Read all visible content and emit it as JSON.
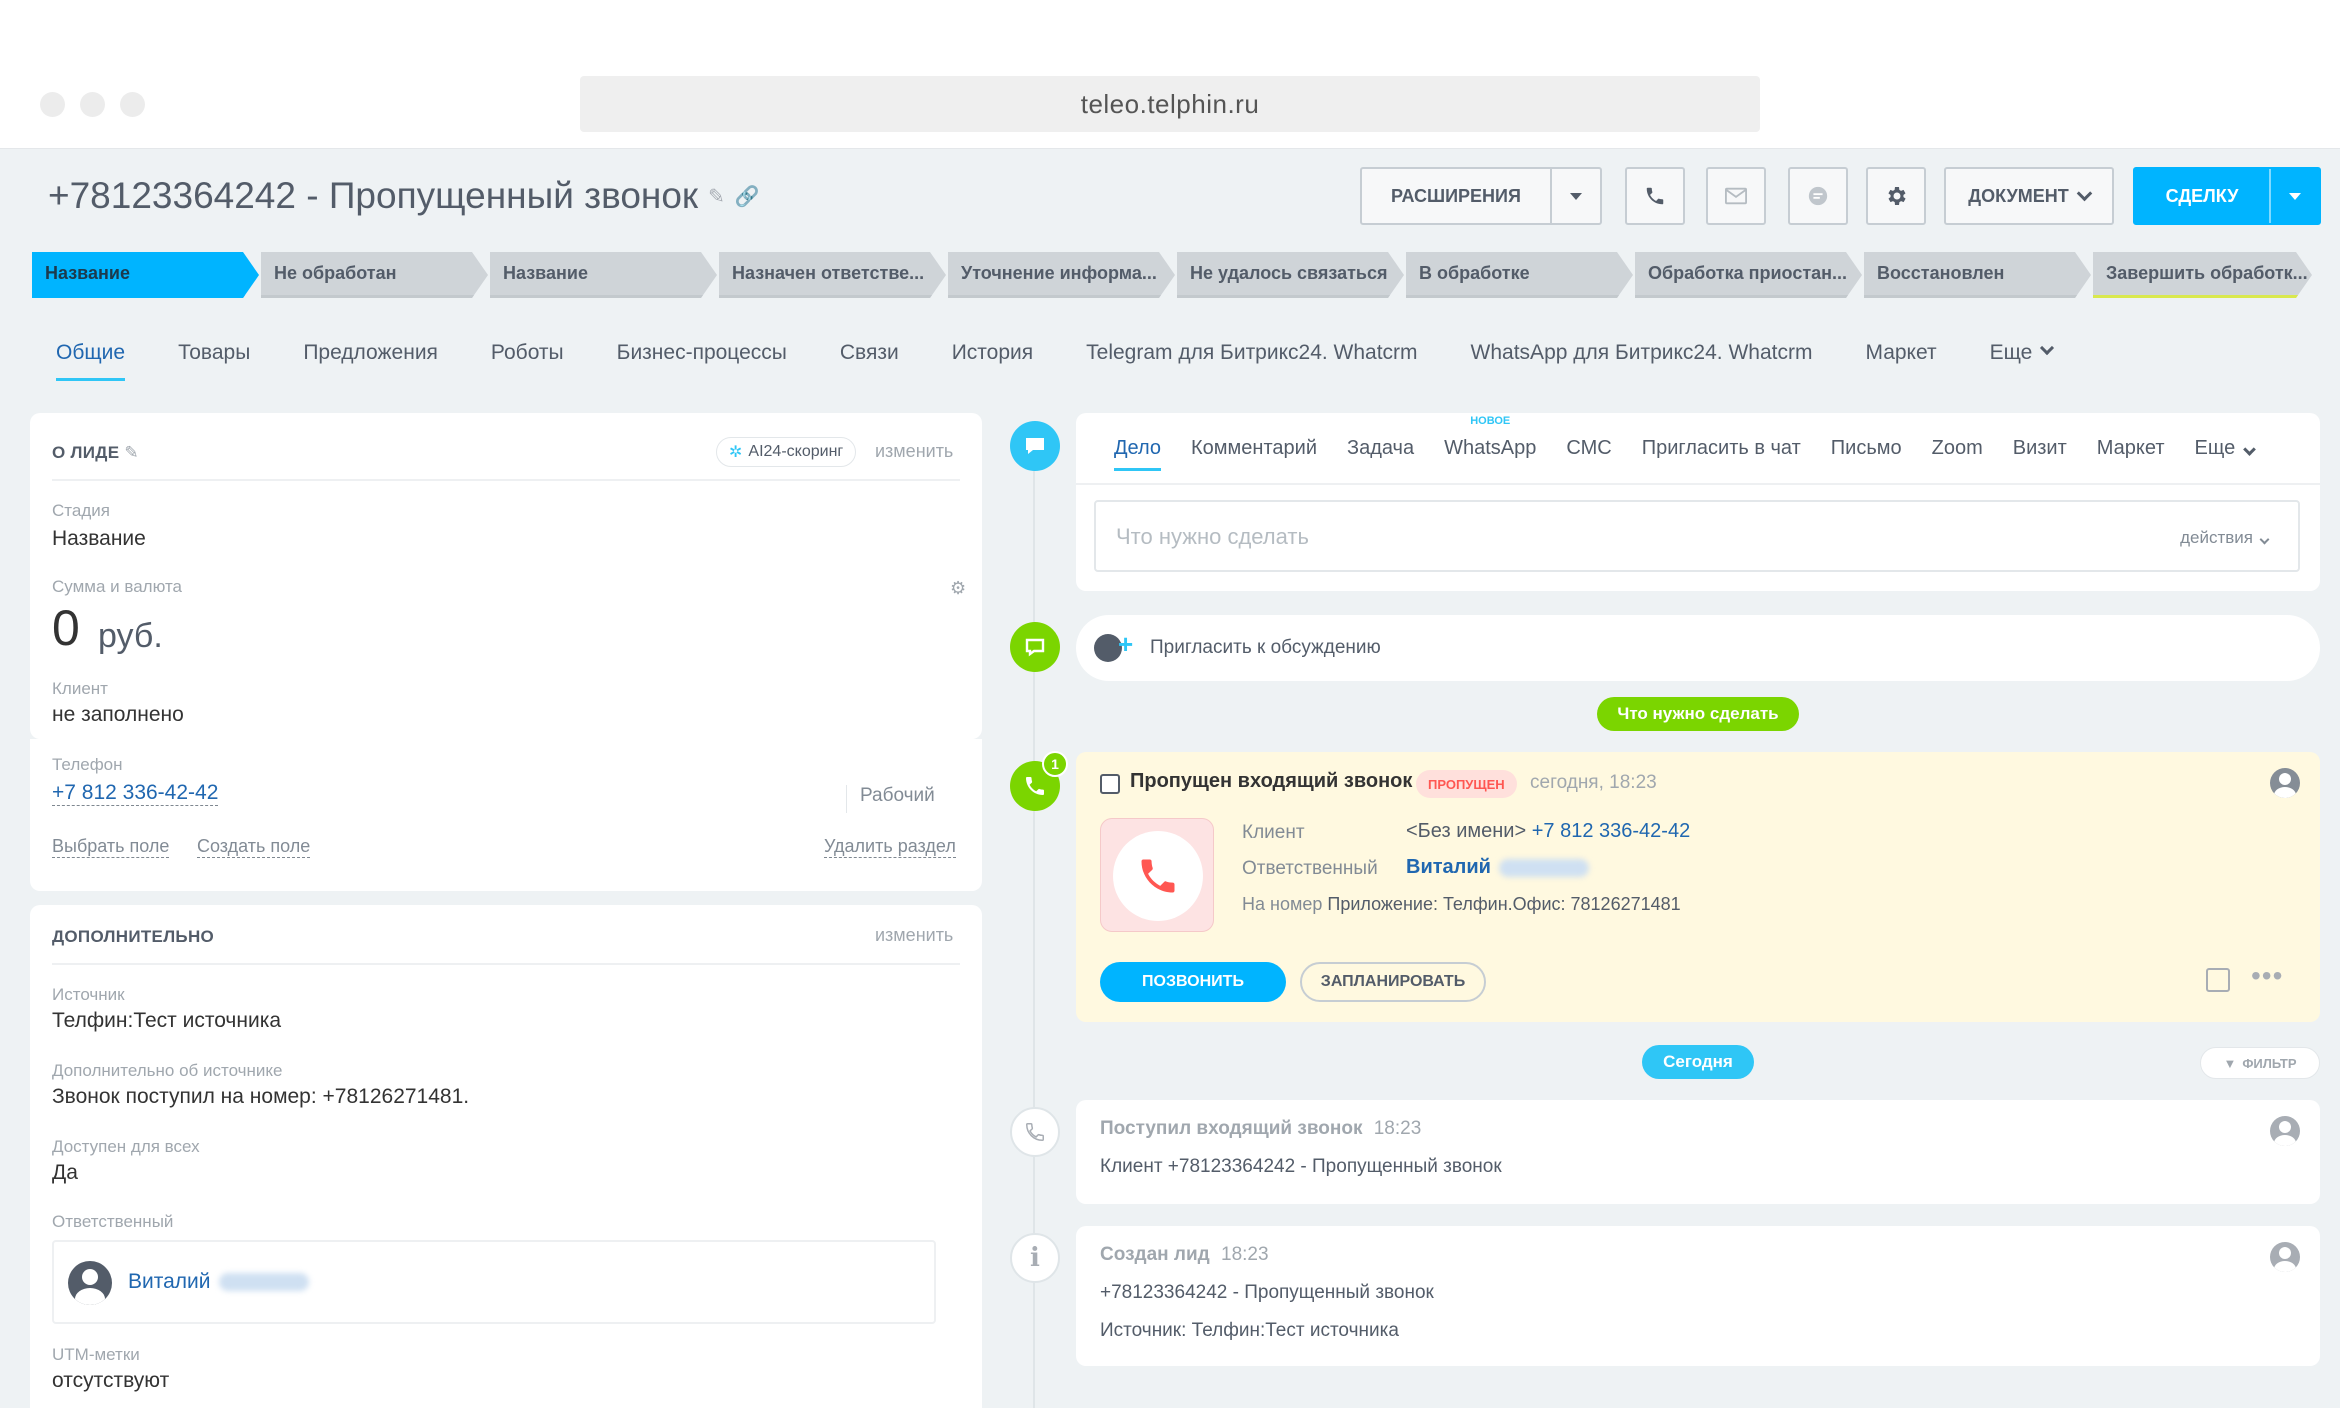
{
  "browser": {
    "url": "teleo.telphin.ru"
  },
  "header": {
    "title": "+78123364242 - Пропущенный звонок",
    "extensions_label": "РАСШИРЕНИЯ",
    "document_label": "ДОКУМЕНТ",
    "deal_label": "СДЕЛКУ"
  },
  "stages": [
    "Название",
    "Не обработан",
    "Название",
    "Назначен ответстве...",
    "Уточнение информа...",
    "Не удалось связаться",
    "В обработке",
    "Обработка приостан...",
    "Восстановлен",
    "Завершить обработк..."
  ],
  "tabs": [
    "Общие",
    "Товары",
    "Предложения",
    "Роботы",
    "Бизнес-процессы",
    "Связи",
    "История",
    "Telegram для Битрикс24. Whatcrm",
    "WhatsApp для Битрикс24. Whatcrm",
    "Маркет",
    "Еще"
  ],
  "lead": {
    "section_title": "О ЛИДЕ",
    "ai_scoring": "AI24-скоринг",
    "edit": "изменить",
    "stage_label": "Стадия",
    "stage_value": "Название",
    "sum_label": "Сумма и валюта",
    "sum_value": "0",
    "currency": "руб.",
    "client_label": "Клиент",
    "client_value": "не заполнено",
    "phone_label": "Телефон",
    "phone_value": "+7 812 336-42-42",
    "phone_type": "Рабочий",
    "select_field": "Выбрать поле",
    "create_field": "Создать поле",
    "delete_section": "Удалить раздел"
  },
  "extra": {
    "section_title": "ДОПОЛНИТЕЛЬНО",
    "edit": "изменить",
    "source_label": "Источник",
    "source_value": "Телфин:Тест источника",
    "source_info_label": "Дополнительно об источнике",
    "source_info_value": "Звонок поступил на номер: +78126271481.",
    "public_label": "Доступен для всех",
    "public_value": "Да",
    "responsible_label": "Ответственный",
    "responsible_name": "Виталий",
    "utm_label": "UTM-метки",
    "utm_value": "отсутствуют"
  },
  "activity": {
    "tabs": [
      "Дело",
      "Комментарий",
      "Задача",
      "WhatsApp",
      "СМС",
      "Пригласить в чат",
      "Письмо",
      "Zoom",
      "Визит",
      "Маркет",
      "Еще"
    ],
    "new_badge": "НОВОЕ",
    "placeholder": "Что нужно сделать",
    "actions": "действия",
    "invite": "Пригласить к обсуждению",
    "todo_pill": "Что нужно сделать"
  },
  "missed_call": {
    "title": "Пропущен входящий звонок",
    "badge": "ПРОПУЩЕН",
    "time": "сегодня, 18:23",
    "counter": "1",
    "client_label": "Клиент",
    "client_name": "<Без имени>",
    "client_phone": "+7 812 336-42-42",
    "responsible_label": "Ответственный",
    "responsible_name": "Виталий",
    "number_label": "На номер",
    "number_value": "Приложение: Телфин.Офис: 78126271481",
    "call_button": "ПОЗВОНИТЬ",
    "plan_button": "ЗАПЛАНИРОВАТЬ"
  },
  "today": {
    "label": "Сегодня",
    "filter": "ФИЛЬТР"
  },
  "history": [
    {
      "title": "Поступил входящий звонок",
      "time": "18:23",
      "lines": [
        "Клиент +78123364242 - Пропущенный звонок"
      ]
    },
    {
      "title": "Создан лид",
      "time": "18:23",
      "lines": [
        "+78123364242 - Пропущенный звонок",
        "Источник: Телфин:Тест источника"
      ]
    }
  ],
  "colors": {
    "accent": "#00b4ff",
    "green": "#7bd500",
    "link": "#2067b0",
    "missed": "#fff9e0"
  }
}
